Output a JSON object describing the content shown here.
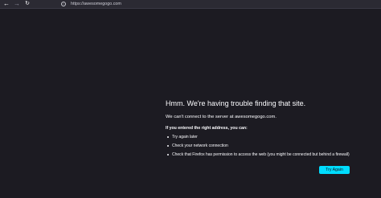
{
  "toolbar": {
    "back_icon": "arrow-left-icon",
    "forward_icon": "arrow-right-icon",
    "reload_icon": "reload-icon",
    "url": "https://awesomegogo.com"
  },
  "error": {
    "title": "Hmm. We're having trouble finding that site.",
    "short_desc": "We can't connect to the server at awesomegogo.com.",
    "hint": "If you entered the right address, you can:",
    "suggestions": [
      "Try again later",
      "Check your network connection",
      "Check that Firefox has permission to access the web (you might be connected but behind a firewall)"
    ],
    "button_label": "Try Again"
  },
  "colors": {
    "background": "#1c1b22",
    "toolbar": "#2b2a33",
    "accent": "#00ddff"
  }
}
